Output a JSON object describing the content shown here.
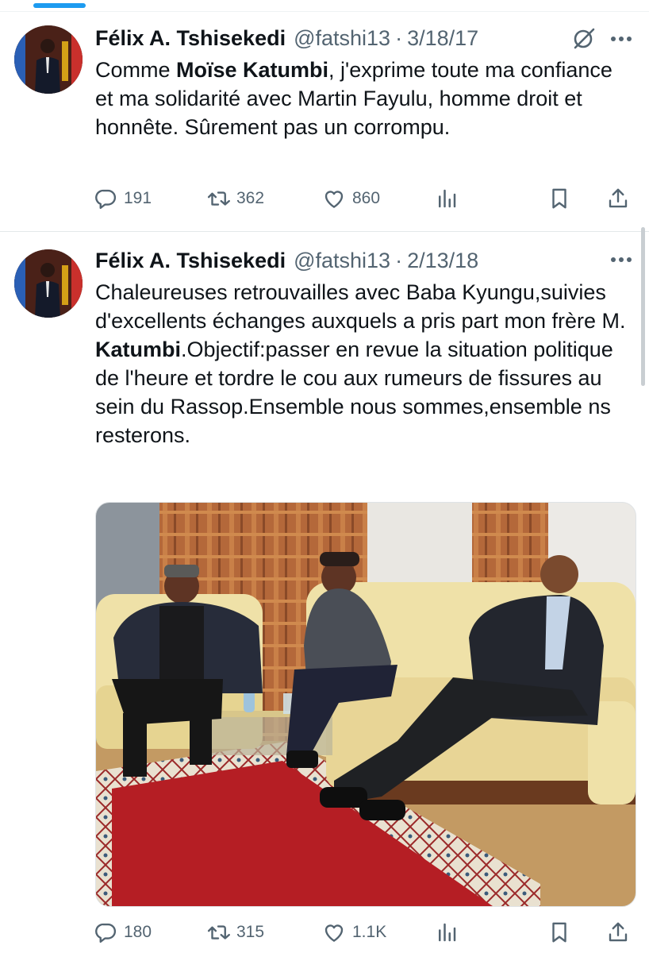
{
  "tweets": [
    {
      "author_name": "Félix A. Tshisekedi",
      "handle": "@fatshi13",
      "separator": "·",
      "date": "3/18/17",
      "text_parts": [
        "Comme ",
        "Moïse Katumbi",
        ", j'exprime toute ma confiance et ma solidarité avec Martin Fayulu, homme droit et honnête. Sûrement pas un corrompu."
      ],
      "replies": "191",
      "reposts": "362",
      "likes": "860"
    },
    {
      "author_name": "Félix A. Tshisekedi",
      "handle": "@fatshi13",
      "separator": "·",
      "date": "2/13/18",
      "text_parts": [
        "Chaleureuses retrouvailles avec Baba Kyungu,suivies d'excellents échanges auxquels a pris part mon frère M. ",
        "Katumbi",
        ".Objectif:passer en revue la situation politique de l'heure et tordre le cou aux rumeurs de fissures au sein du Rassop.Ensemble nous sommes,ensemble ns resterons."
      ],
      "replies": "180",
      "reposts": "315",
      "likes": "1.1K"
    }
  ],
  "icons": [
    "grok-icon",
    "more-icon",
    "reply-icon",
    "repost-icon",
    "like-icon",
    "views-icon",
    "bookmark-icon",
    "share-icon"
  ],
  "colors": {
    "accent": "#1d9bf0",
    "text": "#0f1419",
    "secondary": "#536471"
  }
}
